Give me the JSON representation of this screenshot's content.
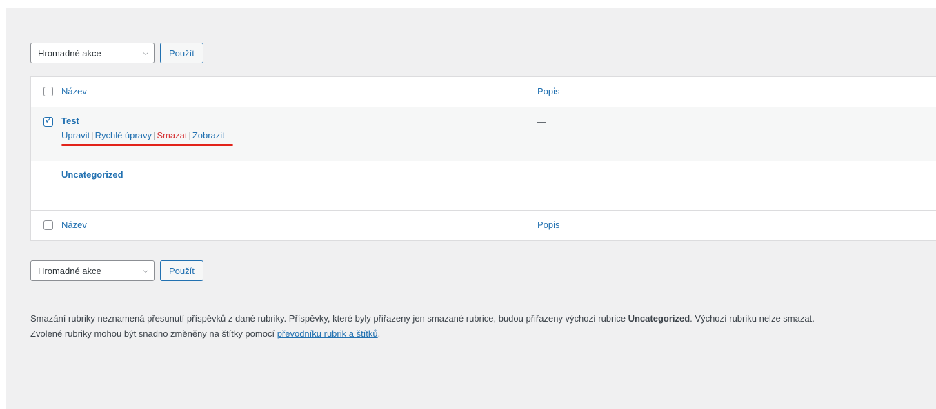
{
  "bulk_top": {
    "select_value": "Hromadné akce",
    "apply_label": "Použít"
  },
  "bulk_bottom": {
    "select_value": "Hromadné akce",
    "apply_label": "Použít"
  },
  "table": {
    "columns": {
      "name": "Název",
      "description": "Popis"
    },
    "rows": [
      {
        "name": "Test",
        "description": "—",
        "checked": true,
        "actions": [
          "Upravit",
          "Rychlé úpravy",
          "Smazat",
          "Zobrazit"
        ]
      },
      {
        "name": "Uncategorized",
        "description": "—",
        "checked": false
      }
    ]
  },
  "note": {
    "line1_start": "Smazání rubriky neznamená přesunutí příspěvků z dané rubriky. Příspěvky, které byly přiřazeny jen smazané rubrice, budou přiřazeny výchozí rubrice ",
    "line1_bold": "Uncategorized",
    "line1_end": ". Výchozí rubriku nelze smazat.",
    "line2_start": "Zvolené rubriky mohou být snadno změněny na štítky pomocí ",
    "line2_link": "převodníku rubrik a štítků",
    "line2_end": "."
  },
  "colors": {
    "link": "#2271b1",
    "delete": "#d63638",
    "annotation": "#e2231a"
  }
}
